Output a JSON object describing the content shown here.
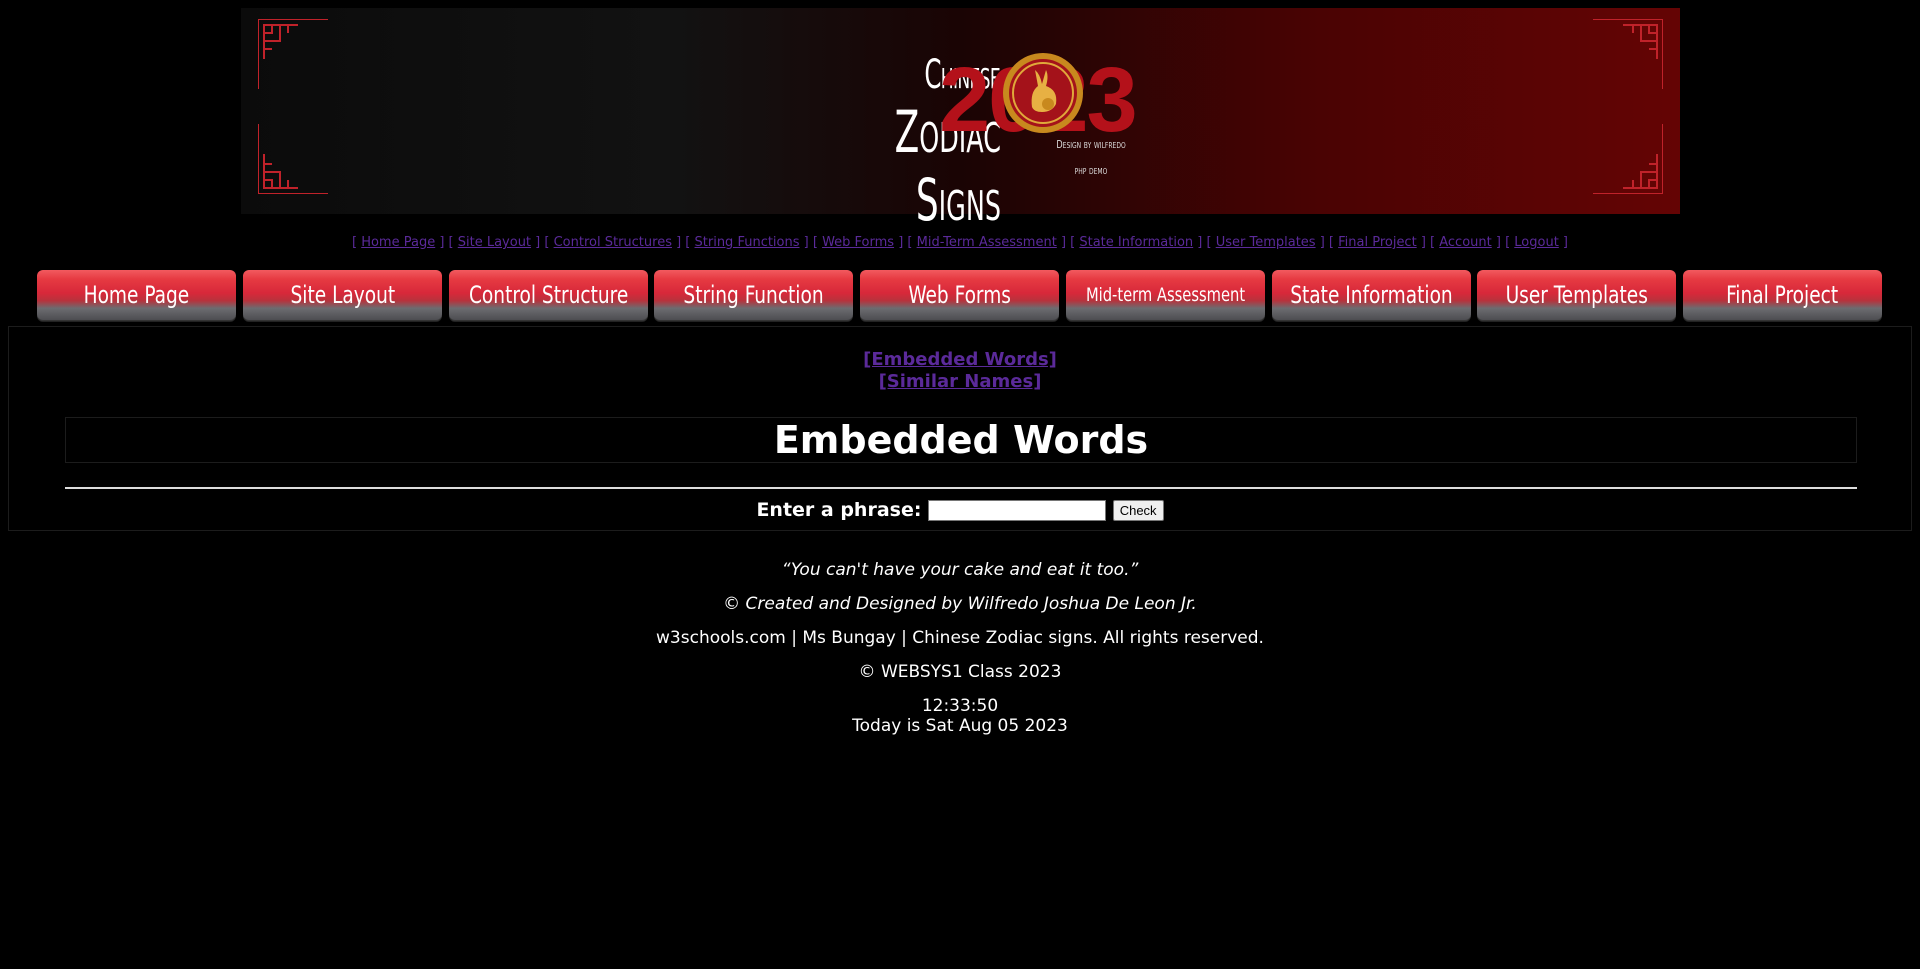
{
  "banner": {
    "title_line1": "Chinese",
    "title_line2": "Zodiac Signs",
    "year": "2023",
    "credit": "Design by wilfredo",
    "subtitle": "php demo"
  },
  "text_nav": [
    {
      "label": "Home Page"
    },
    {
      "label": "Site Layout"
    },
    {
      "label": "Control Structures"
    },
    {
      "label": "String Functions"
    },
    {
      "label": "Web  Forms"
    },
    {
      "label": "Mid-Term Assessment"
    },
    {
      "label": "State Information"
    },
    {
      "label": "User Templates"
    },
    {
      "label": "Final Project"
    },
    {
      "label": "Account"
    },
    {
      "label": "Logout"
    }
  ],
  "button_nav": [
    {
      "label": "Home Page"
    },
    {
      "label": "Site Layout"
    },
    {
      "label": "Control Structure"
    },
    {
      "label": "String Function"
    },
    {
      "label": "Web Forms"
    },
    {
      "label": "Mid-term Assessment"
    },
    {
      "label": "State Information"
    },
    {
      "label": "User Templates"
    },
    {
      "label": "Final Project"
    }
  ],
  "sublinks": {
    "embedded": "[Embedded Words]",
    "similar": "[Similar Names]"
  },
  "main": {
    "heading": "Embedded Words",
    "phrase_label": "Enter a phrase:",
    "phrase_value": "",
    "check_label": "Check"
  },
  "footer": {
    "quote": "“You can't have your cake and eat it too.”",
    "credit": "© Created and Designed by Wilfredo Joshua De Leon Jr.",
    "rights": "w3schools.com | Ms Bungay | Chinese Zodiac signs. All rights reserved.",
    "class": "© WEBSYS1 Class 2023",
    "time": "12:33:50",
    "date": "Today is Sat Aug 05 2023"
  },
  "colors": {
    "link": "#5b2a9a",
    "accent_red": "#b4111a"
  }
}
